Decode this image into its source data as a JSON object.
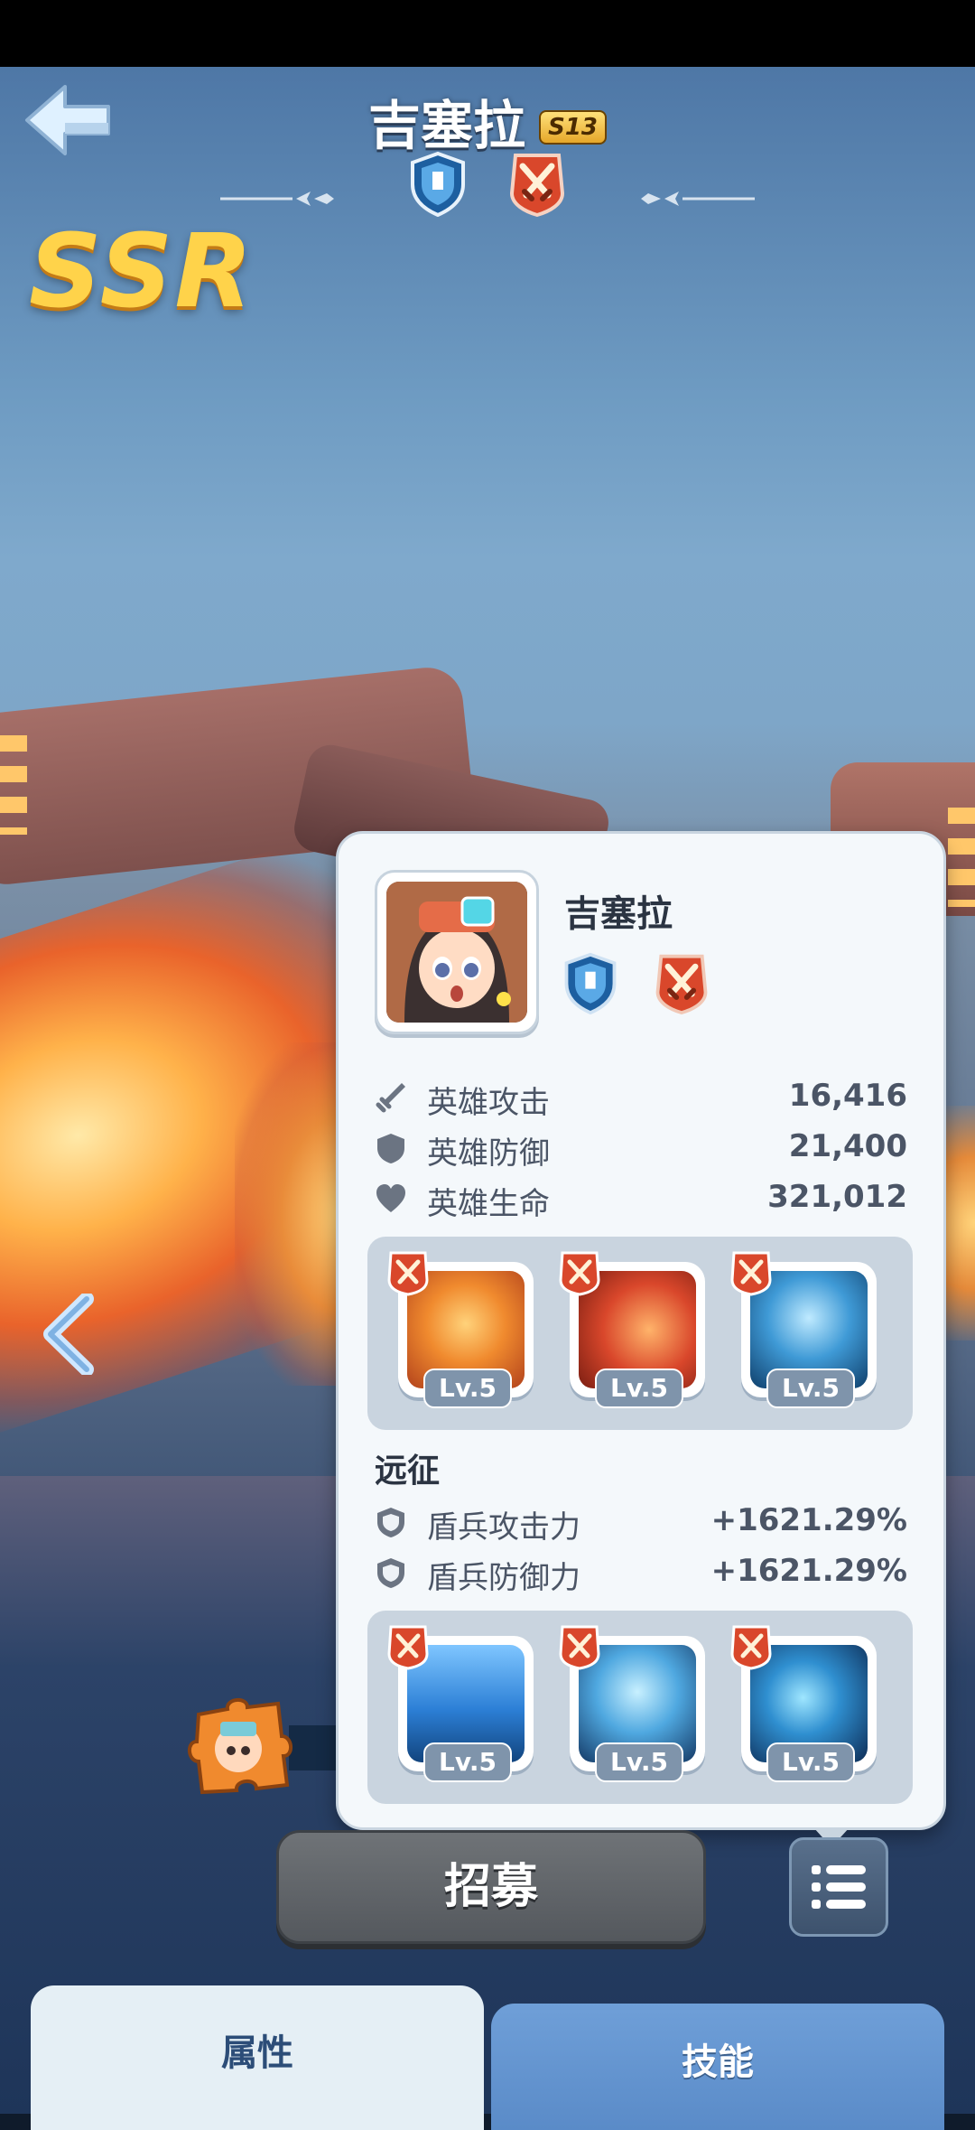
{
  "header": {
    "title": "吉塞拉",
    "season_badge": "S13",
    "rarity": "SSR",
    "icons": [
      "shield-class-icon",
      "crossed-swords-icon"
    ]
  },
  "panel": {
    "hero_name": "吉塞拉",
    "icons": [
      "shield-class-icon",
      "crossed-swords-icon"
    ],
    "stats": [
      {
        "icon": "sword-icon",
        "label": "英雄攻击",
        "value": "16,416"
      },
      {
        "icon": "shield-icon",
        "label": "英雄防御",
        "value": "21,400"
      },
      {
        "icon": "heart-icon",
        "label": "英雄生命",
        "value": "321,012"
      }
    ],
    "skills": [
      {
        "name": "mech-summon-skill",
        "level": "Lv.5"
      },
      {
        "name": "fire-cannon-skill",
        "level": "Lv.5"
      },
      {
        "name": "frost-mech-skill",
        "level": "Lv.5"
      }
    ],
    "expedition_title": "远征",
    "expedition_stats": [
      {
        "icon": "shield-icon",
        "label": "盾兵攻击力",
        "value": "+1621.29%"
      },
      {
        "icon": "shield-icon",
        "label": "盾兵防御力",
        "value": "+1621.29%"
      }
    ],
    "expedition_skills": [
      {
        "name": "blue-shield-skill",
        "level": "Lv.5"
      },
      {
        "name": "ice-shield-skill",
        "level": "Lv.5"
      },
      {
        "name": "frost-warrior-skill",
        "level": "Lv.5"
      }
    ]
  },
  "actions": {
    "recruit_label": "招募"
  },
  "tabs": [
    {
      "label": "属性",
      "active": true
    },
    {
      "label": "技能",
      "active": false
    }
  ],
  "colors": {
    "rarity_gold": "#ffd34a",
    "panel_bg": "#f4f8fb",
    "shield_blue": "#2d7fc1",
    "sword_red": "#d9472b"
  }
}
